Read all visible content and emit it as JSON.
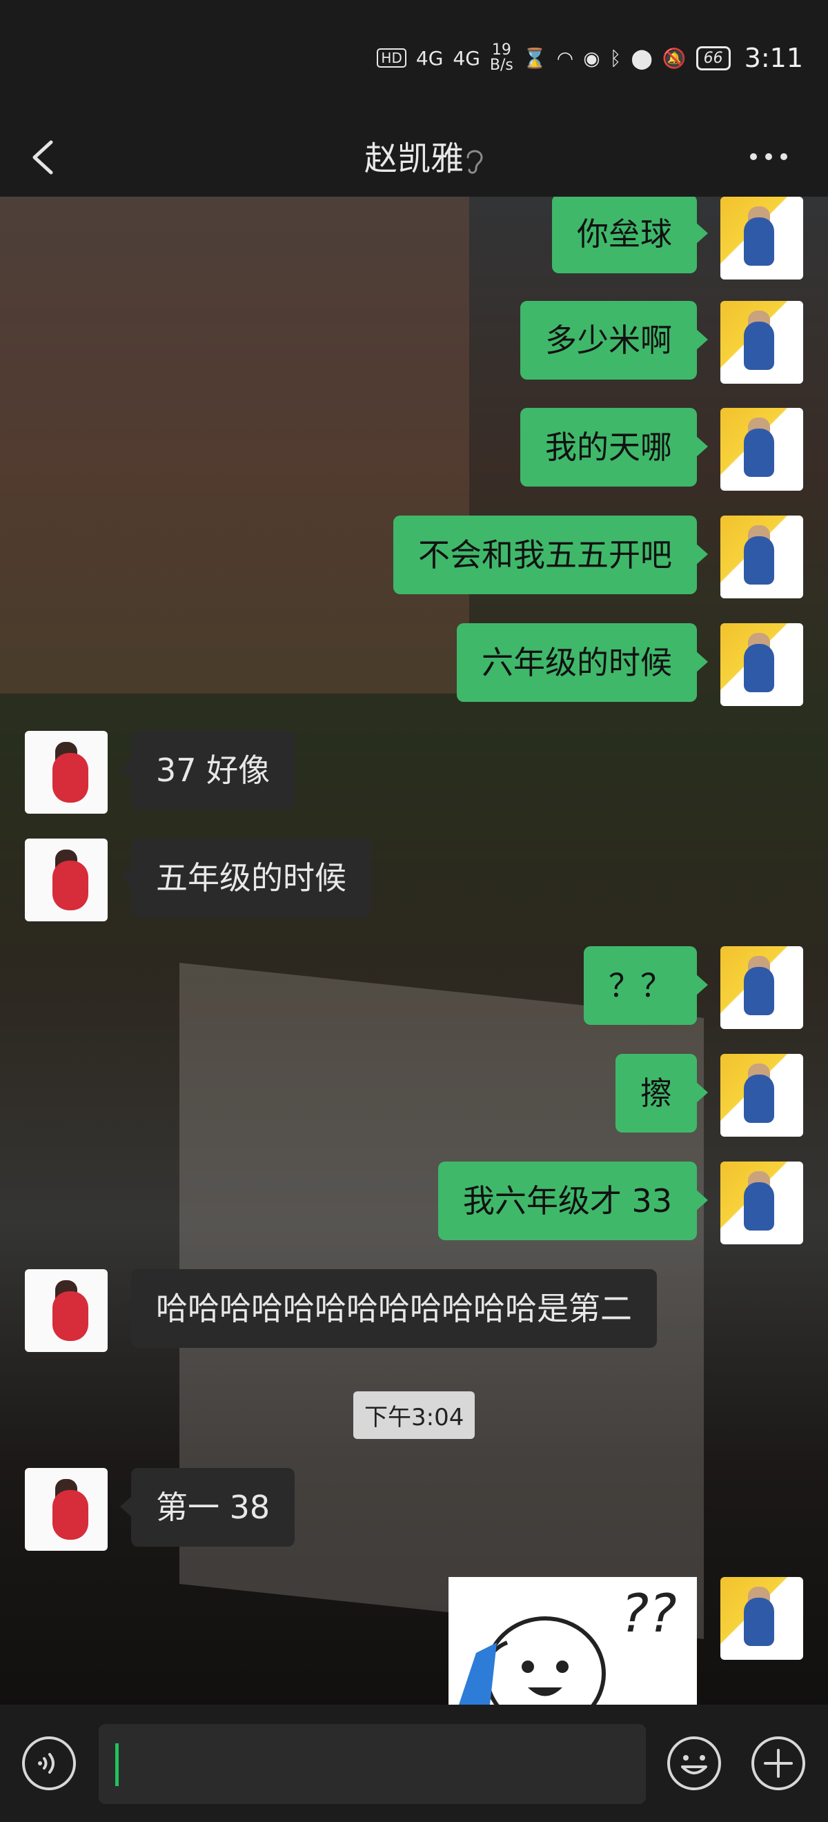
{
  "status_bar": {
    "hd_label": "HD",
    "network_rate_value": "19",
    "network_rate_unit": "B/s",
    "signal_1": "4G",
    "signal_2": "4G",
    "battery": "66",
    "time": "3:11"
  },
  "header": {
    "title": "赵凯雅"
  },
  "messages": [
    {
      "from": "self",
      "text": "你垒球"
    },
    {
      "from": "self",
      "text": "多少米啊"
    },
    {
      "from": "self",
      "text": "我的天哪"
    },
    {
      "from": "self",
      "text": "不会和我五五开吧"
    },
    {
      "from": "self",
      "text": "六年级的时候"
    },
    {
      "from": "other",
      "text": "37 好像"
    },
    {
      "from": "other",
      "text": "五年级的时候"
    },
    {
      "from": "self",
      "text": "？？"
    },
    {
      "from": "self",
      "text": "擦"
    },
    {
      "from": "self",
      "text": "我六年级才 33"
    },
    {
      "from": "other",
      "text": "哈哈哈哈哈哈哈哈哈哈哈哈是第二"
    },
    {
      "from": "other",
      "text": "第一 38"
    }
  ],
  "timestamp": "下午3:04",
  "sticker": {
    "text": "??"
  },
  "colors": {
    "self_bubble": "#3fb86a",
    "other_bubble": "#2a2a2a",
    "caret": "#21c25e"
  },
  "icons": {
    "back": "chevron-left-icon",
    "ear": "ear-icon",
    "more": "more-dots-icon",
    "voice": "voice-icon",
    "emoji": "emoji-icon",
    "plus": "plus-icon"
  }
}
